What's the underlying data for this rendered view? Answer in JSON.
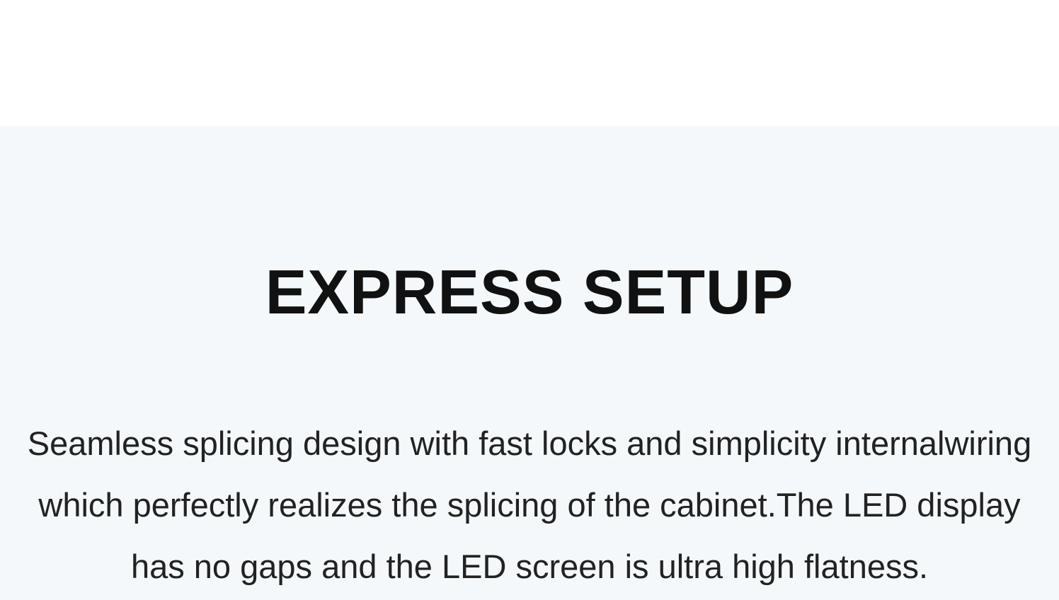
{
  "section": {
    "title": "EXPRESS SETUP",
    "description_lines": [
      "Seamless splicing design with fast locks and simplicity internalwiring",
      "which perfectly realizes the splicing of the cabinet.The LED display",
      "has no gaps and the LED screen is ultra high flatness."
    ]
  },
  "colors": {
    "page_background": "#ffffff",
    "section_background": "#f4f8fa",
    "title_text": "#111111",
    "body_text": "#222222"
  }
}
